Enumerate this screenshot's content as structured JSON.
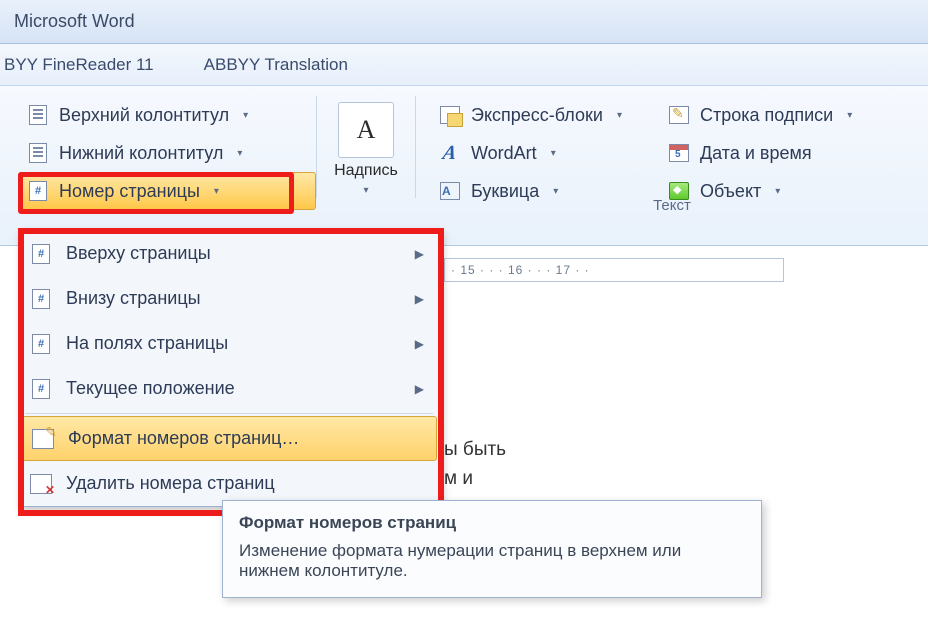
{
  "title": "Microsoft Word",
  "addins": {
    "finereader": "BYY FineReader 11",
    "translation": "ABBYY Translation"
  },
  "ribbon": {
    "header": "Верхний колонтитул",
    "footer": "Нижний колонтитул",
    "page_number": "Номер страницы",
    "textbox": "Надпись",
    "express_blocks": "Экспресс-блоки",
    "wordart": "WordArt",
    "dropcap": "Буквица",
    "signature": "Строка подписи",
    "datetime": "Дата и время",
    "object": "Объект",
    "group_text": "Текст"
  },
  "menu": {
    "top": "Вверху страницы",
    "bottom": "Внизу страницы",
    "margins": "На полях страницы",
    "current": "Текущее положение",
    "format": "Формат номеров страниц…",
    "remove": "Удалить номера страниц"
  },
  "ruler": "· 15 · · · 16 · · · 17 · ·",
  "doc": {
    "line1": "ы быть",
    "line2": "м и"
  },
  "tooltip": {
    "title": "Формат номеров страниц",
    "body": "Изменение формата нумерации страниц в верхнем или нижнем колонтитуле."
  }
}
